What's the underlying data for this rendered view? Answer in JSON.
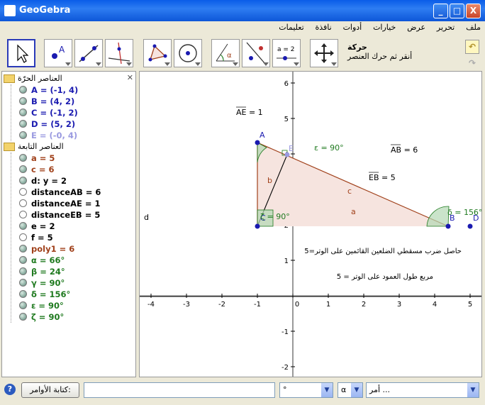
{
  "window": {
    "title": "GeoGebra",
    "buttons": {
      "minimize": "_",
      "maximize": "□",
      "close": "X"
    }
  },
  "menu": [
    "ملف",
    "تحرير",
    "عرض",
    "خيارات",
    "أدوات",
    "نافذة",
    "تعليمات"
  ],
  "tool_info": {
    "name": "حركة",
    "hint": "أنقر ثم حرك العنصر"
  },
  "toolbar": {
    "slider_label": "a = 2"
  },
  "algebra": {
    "free_label": "العناصر الحرّة",
    "dependent_label": "العناصر التابعة",
    "free": [
      {
        "text": "A = (-1, 4)",
        "color": "#1a1ab0",
        "shown": true
      },
      {
        "text": "B = (4, 2)",
        "color": "#1a1ab0",
        "shown": true
      },
      {
        "text": "C = (-1, 2)",
        "color": "#1a1ab0",
        "shown": true
      },
      {
        "text": "D = (5, 2)",
        "color": "#1a1ab0",
        "shown": true
      },
      {
        "text": "E = (-0, 4)",
        "color": "#9a9ae0",
        "shown": true
      }
    ],
    "dependent": [
      {
        "text": "a = 5",
        "color": "#a0401a",
        "shown": true
      },
      {
        "text": "c = 6",
        "color": "#a0401a",
        "shown": true
      },
      {
        "text": "d: y = 2",
        "color": "#000000",
        "shown": true
      },
      {
        "text": "distanceAB = 6",
        "color": "#000000",
        "shown": false
      },
      {
        "text": "distanceAE = 1",
        "color": "#000000",
        "shown": false
      },
      {
        "text": "distanceEB = 5",
        "color": "#000000",
        "shown": false
      },
      {
        "text": "e = 2",
        "color": "#000000",
        "shown": true
      },
      {
        "text": "f = 5",
        "color": "#000000",
        "shown": false
      },
      {
        "text": "poly1 = 6",
        "color": "#a0401a",
        "shown": true
      },
      {
        "text": "α = 66°",
        "color": "#1f7a1f",
        "shown": true
      },
      {
        "text": "β = 24°",
        "color": "#1f7a1f",
        "shown": true
      },
      {
        "text": "γ = 90°",
        "color": "#1f7a1f",
        "shown": true
      },
      {
        "text": "δ = 156°",
        "color": "#1f7a1f",
        "shown": true
      },
      {
        "text": "ε = 90°",
        "color": "#1f7a1f",
        "shown": true
      },
      {
        "text": "ζ = 90°",
        "color": "#1f7a1f",
        "shown": true
      }
    ]
  },
  "graphics": {
    "x_ticks": [
      "-4",
      "-3",
      "-2",
      "-1",
      "0",
      "1",
      "2",
      "3",
      "4",
      "5"
    ],
    "y_ticks": [
      "-2",
      "-1",
      "0",
      "1",
      "2",
      "3",
      "4",
      "5",
      "6"
    ],
    "points": {
      "A": "A",
      "B": "B",
      "C": "C",
      "D": "D",
      "E": "E"
    },
    "segments": {
      "a": "a",
      "b": "b",
      "c": "c",
      "d": "d"
    },
    "texts": {
      "ae": "AE = 1",
      "ab": "AB = 6",
      "eb": "EB = 5",
      "epsilon": "ε = 90°",
      "zeta": "ζ = 90°",
      "delta": "δ = 156°",
      "product": "حاصل ضرب مسقطي الضلعين القائمين على الوتر=5",
      "square": "مربع طول العمود على الوتر = 5"
    }
  },
  "input_bar": {
    "label": "كتابة الأوامر:",
    "value": "",
    "degree_combo": "°",
    "greek_combo": "α",
    "command_combo": "أمر ..."
  },
  "colors": {
    "accent": "#0a5ce8",
    "point": "#1a1ab0",
    "polygon_fill": "#f6e4df",
    "polygon_stroke": "#a0401a",
    "angle": "#1f7a1f"
  }
}
